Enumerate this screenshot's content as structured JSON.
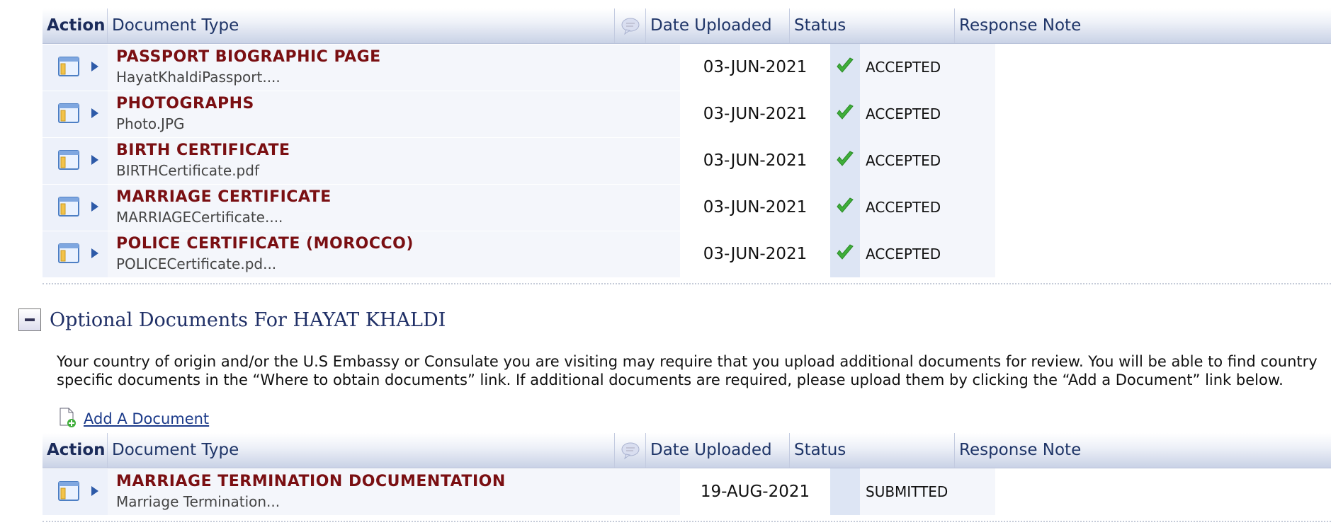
{
  "headers": {
    "action": "Action",
    "document_type": "Document Type",
    "date_uploaded": "Date Uploaded",
    "status": "Status",
    "response_note": "Response Note"
  },
  "required_documents": [
    {
      "title": "PASSPORT BIOGRAPHIC PAGE",
      "file": "HayatKhaldiPassport....",
      "date": "03-JUN-2021",
      "status": "ACCEPTED"
    },
    {
      "title": "PHOTOGRAPHS",
      "file": "Photo.JPG",
      "date": "03-JUN-2021",
      "status": "ACCEPTED"
    },
    {
      "title": "BIRTH CERTIFICATE",
      "file": "BIRTHCertificate.pdf",
      "date": "03-JUN-2021",
      "status": "ACCEPTED"
    },
    {
      "title": "MARRIAGE CERTIFICATE",
      "file": "MARRIAGECertificate....",
      "date": "03-JUN-2021",
      "status": "ACCEPTED"
    },
    {
      "title": "POLICE CERTIFICATE (MOROCCO)",
      "file": "POLICECertificate.pd...",
      "date": "03-JUN-2021",
      "status": "ACCEPTED"
    }
  ],
  "optional_section": {
    "title": "Optional Documents For HAYAT KHALDI",
    "description": "Your country of origin and/or the U.S Embassy or Consulate you are visiting may require that you upload additional documents for review. You will be able to find country specific documents in the “Where to obtain documents” link. If additional documents are required, please upload them by clicking the “Add a Document” link below.",
    "add_link": "Add A Document"
  },
  "optional_documents": [
    {
      "title": "MARRIAGE TERMINATION DOCUMENTATION",
      "file": "Marriage Termination...",
      "date": "19-AUG-2021",
      "status": "SUBMITTED"
    }
  ],
  "colors": {
    "doc_title": "#7a0f12",
    "header_text": "#1f3568",
    "accepted_check": "#3fae3a",
    "link": "#1c3b8a"
  },
  "icons": {
    "row_action": "document-view-icon",
    "row_expand": "expand-arrow-icon",
    "note_header": "speech-bubble-icon",
    "accepted": "checkmark-icon",
    "add": "add-document-icon",
    "collapse": "collapse-icon"
  }
}
